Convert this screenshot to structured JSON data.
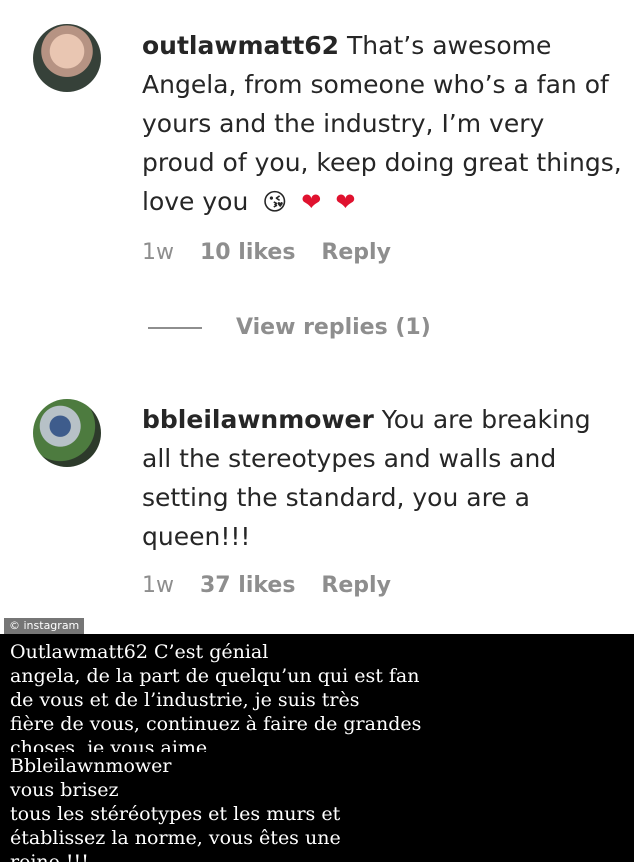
{
  "comments": [
    {
      "username": "outlawmatt62",
      "text": "That’s awesome Angela, from someone who’s a fan of yours and the industry, I’m very proud of you, keep doing great things, love you",
      "emojis": [
        "😘",
        "❤",
        "❤"
      ],
      "time": "1w",
      "likes": "10 likes",
      "reply": "Reply",
      "view_replies": "View replies (1)"
    },
    {
      "username": "bbleilawnmower",
      "text": "You are breaking all the stereotypes and walls and setting the standard, you are a queen!!!",
      "time": "1w",
      "likes": "37 likes",
      "reply": "Reply"
    }
  ],
  "credit": "© instagram",
  "translation": {
    "first": [
      "Outlawmatt62 C’est génial",
      "angela, de la part de quelqu’un qui est fan",
      "de vous et de l’industrie, je suis très",
      "fière de vous, continuez à faire de grandes",
      "choses, je vous aime"
    ],
    "second": [
      "Bbleilawnmower",
      "vous brisez",
      "tous les stéréotypes et les murs et",
      "établissez la norme, vous êtes une",
      "reine !!!"
    ]
  }
}
